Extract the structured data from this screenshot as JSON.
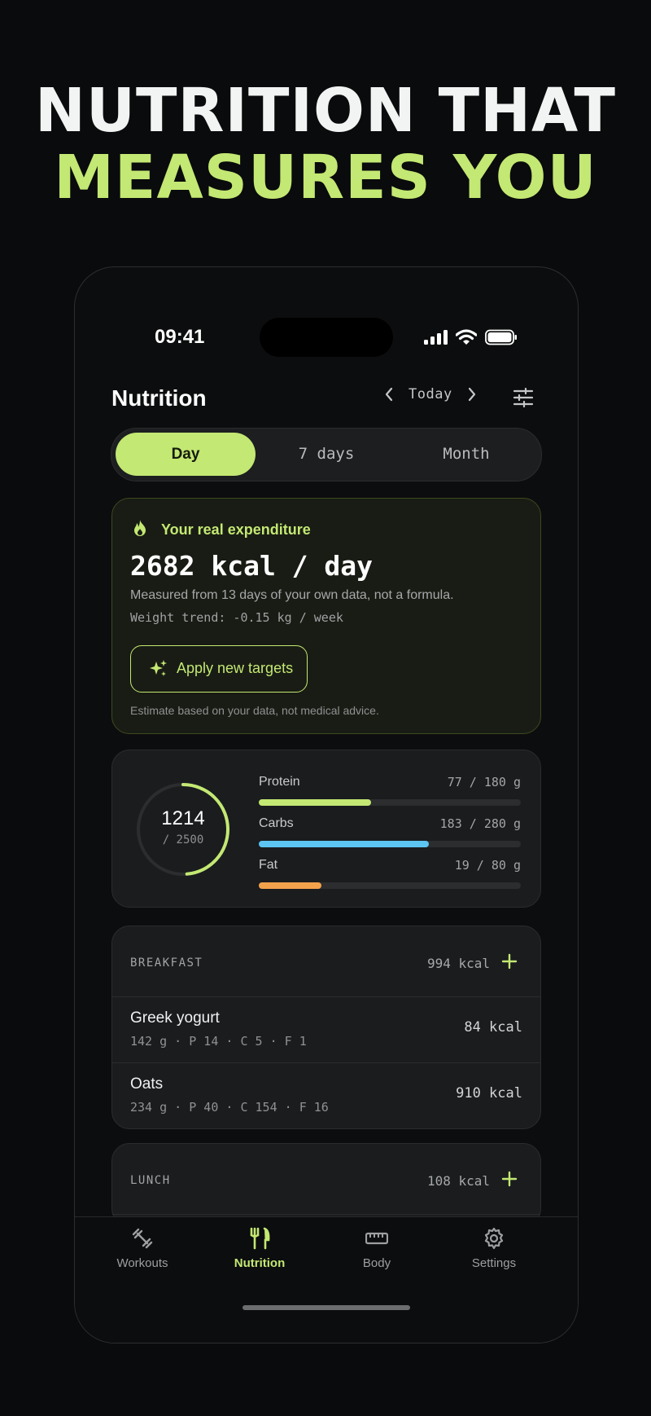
{
  "headline": {
    "line1": "NUTRITION THAT",
    "line2": "MEASURES YOU"
  },
  "status_bar": {
    "time": "09:41"
  },
  "header": {
    "title": "Nutrition",
    "date_label": "Today"
  },
  "segments": [
    "Day",
    "7 days",
    "Month"
  ],
  "active_segment": "Day",
  "expenditure": {
    "title": "Your real expenditure",
    "kcal": "2682 kcal / day",
    "measured": "Measured from 13 days of your own data, not a formula.",
    "trend": "Weight trend: -0.15 kg / week",
    "button": "Apply new targets",
    "disclaimer": "Estimate based on your data, not medical advice."
  },
  "ring": {
    "value": "1214",
    "goal": "/ 2500",
    "progress": 0.4856
  },
  "macros": [
    {
      "name": "Protein",
      "value": "77 / 180 g",
      "fraction": 0.43,
      "color": "#c3e873"
    },
    {
      "name": "Carbs",
      "value": "183 / 280 g",
      "fraction": 0.65,
      "color": "#5cc5f2"
    },
    {
      "name": "Fat",
      "value": "19 / 80 g",
      "fraction": 0.24,
      "color": "#f3a24c"
    }
  ],
  "breakfast": {
    "name": "BREAKFAST",
    "kcal": "994 kcal",
    "items": [
      {
        "name": "Greek yogurt",
        "detail": "142 g · P 14 · C 5 · F 1",
        "kcal": "84 kcal"
      },
      {
        "name": "Oats",
        "detail": "234 g · P 40 · C 154 · F 16",
        "kcal": "910 kcal"
      }
    ]
  },
  "lunch": {
    "name": "LUNCH",
    "kcal": "108 kcal"
  },
  "tabs": [
    {
      "label": "Workouts",
      "icon": "dumbbell-icon"
    },
    {
      "label": "Nutrition",
      "icon": "fork-knife-icon"
    },
    {
      "label": "Body",
      "icon": "ruler-icon"
    },
    {
      "label": "Settings",
      "icon": "gear-icon"
    }
  ],
  "active_tab": "Nutrition",
  "colors": {
    "accent": "#c3e873",
    "background": "#0a0b0c",
    "card": "#1a1c1e"
  }
}
